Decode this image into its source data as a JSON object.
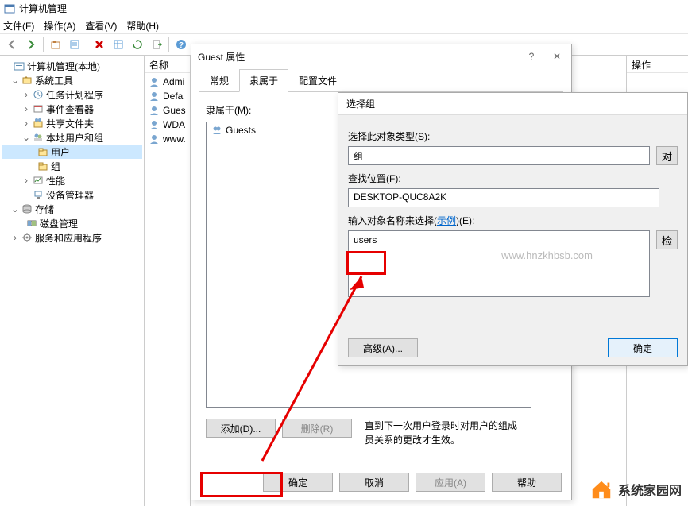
{
  "window": {
    "title": "计算机管理"
  },
  "menu": {
    "file": "文件(F)",
    "action": "操作(A)",
    "view": "查看(V)",
    "help": "帮助(H)"
  },
  "tree": {
    "root": "计算机管理(本地)",
    "sys_tools": "系统工具",
    "task_sched": "任务计划程序",
    "event_viewer": "事件查看器",
    "shared_folders": "共享文件夹",
    "local_users": "本地用户和组",
    "users": "用户",
    "groups": "组",
    "performance": "性能",
    "device_mgr": "设备管理器",
    "storage": "存储",
    "disk_mgmt": "磁盘管理",
    "services_apps": "服务和应用程序"
  },
  "list": {
    "header": "名称",
    "items": [
      "Admi",
      "Defa",
      "Gues",
      "WDA",
      "www."
    ]
  },
  "ops": {
    "header": "操作"
  },
  "prop_dialog": {
    "title": "Guest 属性",
    "tabs": {
      "general": "常规",
      "member_of": "隶属于",
      "profile": "配置文件"
    },
    "member_of_label": "隶属于(M):",
    "group_item": "Guests",
    "add_btn": "添加(D)...",
    "remove_btn": "删除(R)",
    "note": "直到下一次用户登录时对用户的组成员关系的更改才生效。",
    "ok": "确定",
    "cancel": "取消",
    "apply": "应用(A)",
    "help": "帮助"
  },
  "sel_dialog": {
    "title": "选择组",
    "obj_type_label": "选择此对象类型(S):",
    "obj_type_value": "组",
    "obj_type_btn": "对",
    "location_label": "查找位置(F):",
    "location_value": "DESKTOP-QUC8A2K",
    "names_label_prefix": "输入对象名称来选择(",
    "names_label_link": "示例",
    "names_label_suffix": ")(E):",
    "names_value": "users",
    "check_btn": "检",
    "advanced_btn": "高级(A)...",
    "ok": "确定"
  },
  "watermark": "www.hnzkhbsb.com",
  "logo": {
    "line1": "系统家园网"
  }
}
